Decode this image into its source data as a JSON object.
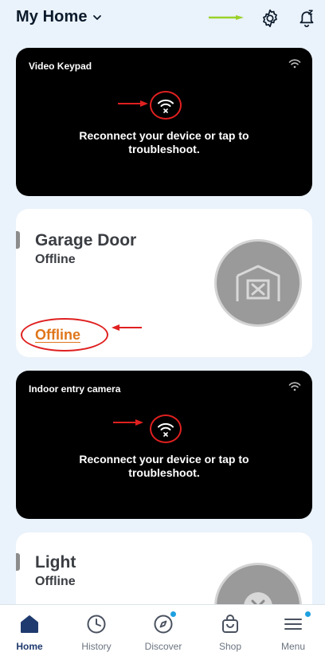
{
  "header": {
    "home_title": "My Home",
    "icons": [
      "chevron-down-icon",
      "settings-gear-icon",
      "snooze-bell-icon"
    ],
    "annotation_arrow_color": "#9ad12a"
  },
  "cards": {
    "video_keypad": {
      "name": "Video Keypad",
      "message": "Reconnect your device or tap to troubleshoot.",
      "icon": "wifi-off-icon"
    },
    "garage_door": {
      "name": "Garage Door",
      "status": "Offline",
      "link": "Offline",
      "accent": "#e0761b"
    },
    "indoor_camera": {
      "name": "Indoor entry camera",
      "message": "Reconnect your device or tap to troubleshoot.",
      "icon": "wifi-off-icon"
    },
    "light": {
      "name": "Light",
      "status": "Offline"
    }
  },
  "annotations": {
    "circle_color": "#e02020"
  },
  "nav": {
    "items": [
      {
        "label": "Home",
        "icon": "home-icon",
        "active": true
      },
      {
        "label": "History",
        "icon": "clock-icon"
      },
      {
        "label": "Discover",
        "icon": "compass-icon"
      },
      {
        "label": "Shop",
        "icon": "shopping-bag-icon"
      },
      {
        "label": "Menu",
        "icon": "hamburger-menu-icon"
      }
    ],
    "active_color": "#1f3a6e",
    "badge_color": "#1fa0e0"
  }
}
